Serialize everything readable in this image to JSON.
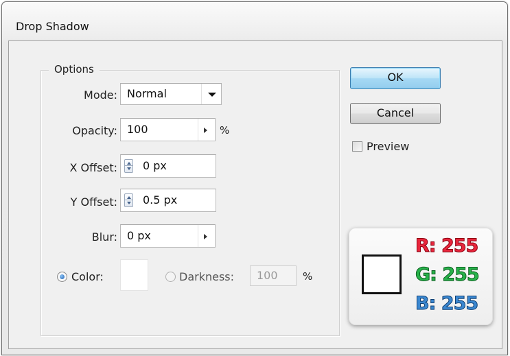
{
  "window": {
    "title": "Drop Shadow"
  },
  "options": {
    "legend": "Options",
    "mode": {
      "label": "Mode:",
      "value": "Normal"
    },
    "opacity": {
      "label": "Opacity:",
      "value": "100",
      "unit": "%"
    },
    "x_offset": {
      "label": "X Offset:",
      "value": "0 px"
    },
    "y_offset": {
      "label": "Y Offset:",
      "value": "0.5 px"
    },
    "blur": {
      "label": "Blur:",
      "value": "0 px"
    },
    "color": {
      "label": "Color:",
      "selected": true,
      "swatch": "#ffffff"
    },
    "darkness": {
      "label": "Darkness:",
      "value": "100",
      "unit": "%",
      "selected": false
    }
  },
  "buttons": {
    "ok": "OK",
    "cancel": "Cancel"
  },
  "preview": {
    "label": "Preview",
    "checked": false
  },
  "color_info": {
    "r": "R: 255",
    "g": "G: 255",
    "b": "B: 255",
    "swatch": "#ffffff"
  }
}
